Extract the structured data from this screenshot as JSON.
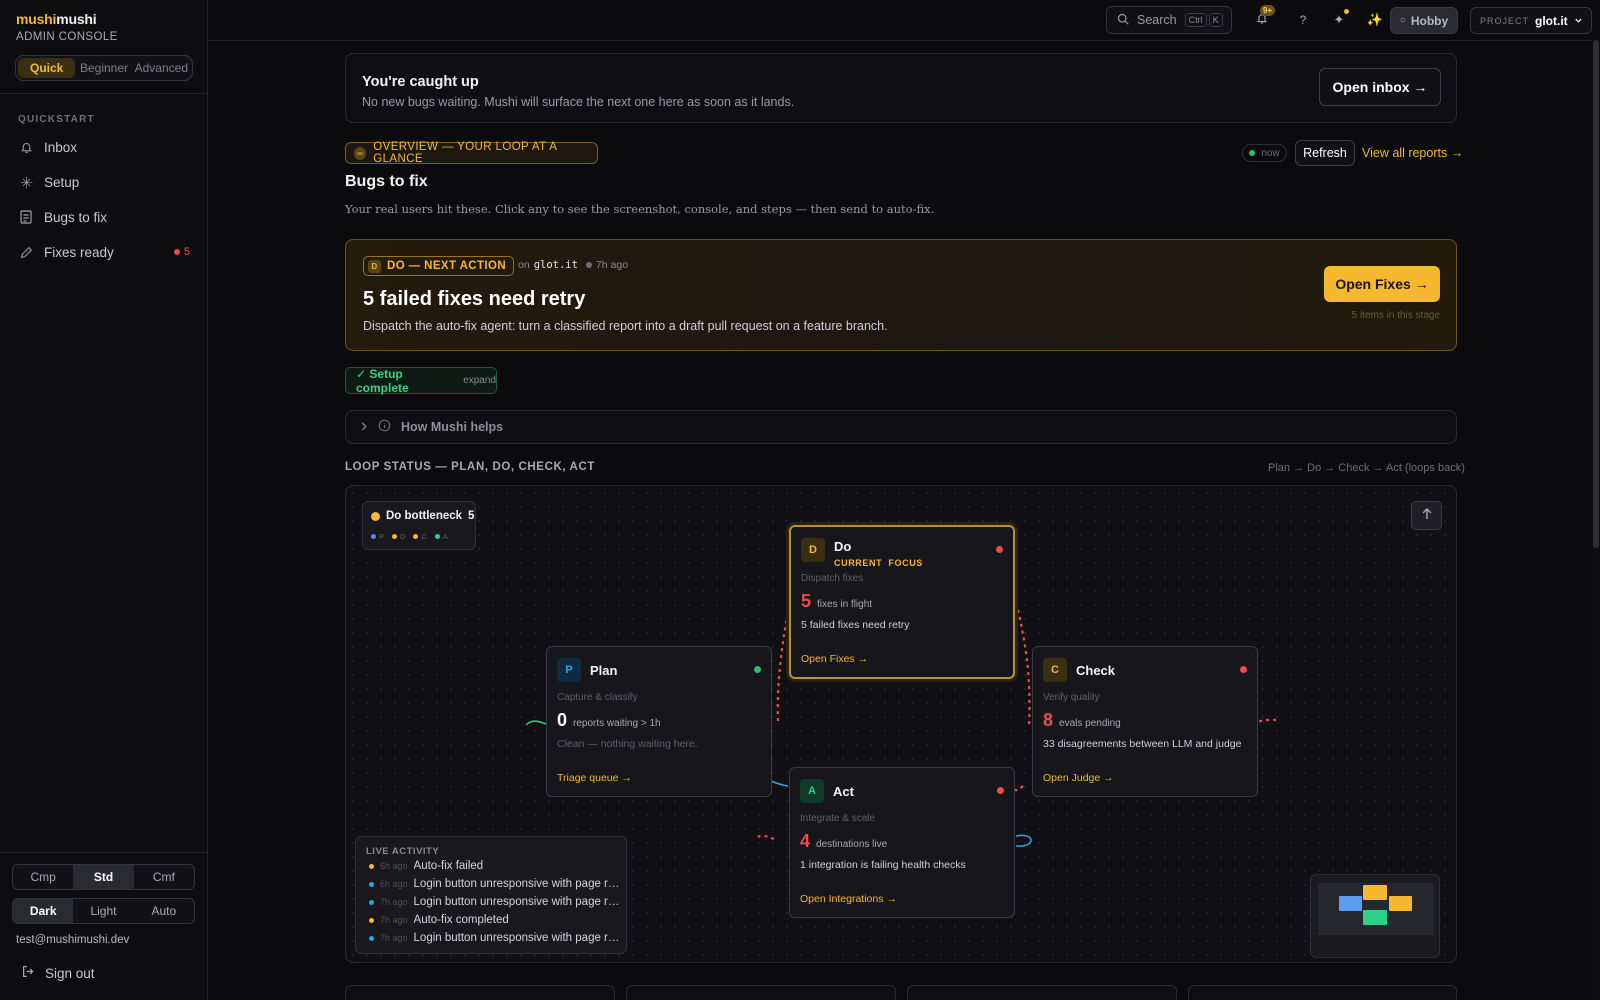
{
  "brand": {
    "part1": "mushi",
    "part2": "mushi",
    "subtitle": "ADMIN CONSOLE"
  },
  "mode": {
    "options": [
      "Quick",
      "Beginner",
      "Advanced"
    ],
    "selected": "Quick"
  },
  "sidebar": {
    "section": "QUICKSTART",
    "items": [
      {
        "label": "Inbox",
        "icon": "bell-icon"
      },
      {
        "label": "Setup",
        "icon": "sparkle-icon"
      },
      {
        "label": "Bugs to fix",
        "icon": "document-icon"
      },
      {
        "label": "Fixes ready",
        "icon": "pencil-icon",
        "badge": "5"
      }
    ],
    "density": {
      "options": [
        "Cmp",
        "Std",
        "Cmf"
      ],
      "selected": "Std"
    },
    "theme": {
      "options": [
        "Dark",
        "Light",
        "Auto"
      ],
      "selected": "Dark"
    },
    "user_email": "test@mushimushi.dev",
    "sign_out": "Sign out"
  },
  "topbar": {
    "search_label": "Search",
    "search_kbd": [
      "Ctrl",
      "K"
    ],
    "notif_badge": "9+",
    "help_label": "?",
    "plan": "Hobby",
    "project_label": "PROJECT",
    "project_value": "glot.it"
  },
  "caughtup": {
    "title": "You're caught up",
    "subtitle": "No new bugs waiting. Mushi will surface the next one here as soon as it lands.",
    "button": "Open inbox →"
  },
  "overview": {
    "pill": "OVERVIEW — YOUR LOOP AT A GLANCE",
    "now": "now",
    "refresh": "Refresh",
    "view_all": "View all reports →",
    "title": "Bugs to fix",
    "subtitle": "Your real users hit these. Click any to see the screenshot, console, and steps — then send to auto-fix."
  },
  "next_action": {
    "letter": "D",
    "pill": "DO — NEXT ACTION",
    "on": "on",
    "domain": "glot.it",
    "ago": "7h ago",
    "title": "5 failed fixes need retry",
    "description": "Dispatch the auto-fix agent: turn a classified report into a draft pull request on a feature branch.",
    "button": "Open Fixes →",
    "items_note": "5 items in this stage"
  },
  "setup": {
    "label": "✓ Setup complete",
    "expand": "expand"
  },
  "how_helps": "How Mushi helps",
  "loop": {
    "title": "LOOP STATUS — PLAN, DO, CHECK, ACT",
    "hint": "Plan → Do → Check → Act (loops back)",
    "bottleneck": {
      "label": "Do bottleneck",
      "count": "5",
      "legend": [
        "P",
        "D",
        "C",
        "A"
      ]
    },
    "nodes": {
      "do": {
        "letter": "D",
        "name": "Do",
        "current": "CURRENT",
        "focus": "FOCUS",
        "desc": "Dispatch fixes",
        "count": "5",
        "metric": "fixes in flight",
        "note": "5 failed fixes need retry",
        "link": "Open Fixes →"
      },
      "plan": {
        "letter": "P",
        "name": "Plan",
        "desc": "Capture & classify",
        "count": "0",
        "metric": "reports waiting > 1h",
        "note": "Clean — nothing waiting here.",
        "link": "Triage queue →"
      },
      "check": {
        "letter": "C",
        "name": "Check",
        "desc": "Verify quality",
        "count": "8",
        "metric": "evals pending",
        "note": "33 disagreements between LLM and judge",
        "link": "Open Judge →"
      },
      "act": {
        "letter": "A",
        "name": "Act",
        "desc": "Integrate & scale",
        "count": "4",
        "metric": "destinations live",
        "note": "1 integration is failing health checks",
        "link": "Open Integrations →"
      }
    },
    "live_activity": {
      "title": "LIVE ACTIVITY",
      "rows": [
        {
          "ago": "6h ago",
          "text": "Auto-fix failed",
          "color": "#f5b82e"
        },
        {
          "ago": "6h ago",
          "text": "Login button unresponsive with page refresh",
          "color": "#2aa7e6"
        },
        {
          "ago": "7h ago",
          "text": "Login button unresponsive with page refresh",
          "color": "#2aa7e6"
        },
        {
          "ago": "7h ago",
          "text": "Auto-fix completed",
          "color": "#f5b82e"
        },
        {
          "ago": "7h ago",
          "text": "Login button unresponsive with page refresh",
          "color": "#2aa7e6"
        }
      ]
    }
  },
  "colors": {
    "accent": "#f5b82e",
    "danger": "#f04a4a",
    "success": "#2ac16a",
    "plan": "#2aa7e6",
    "act": "#2fd08a"
  }
}
